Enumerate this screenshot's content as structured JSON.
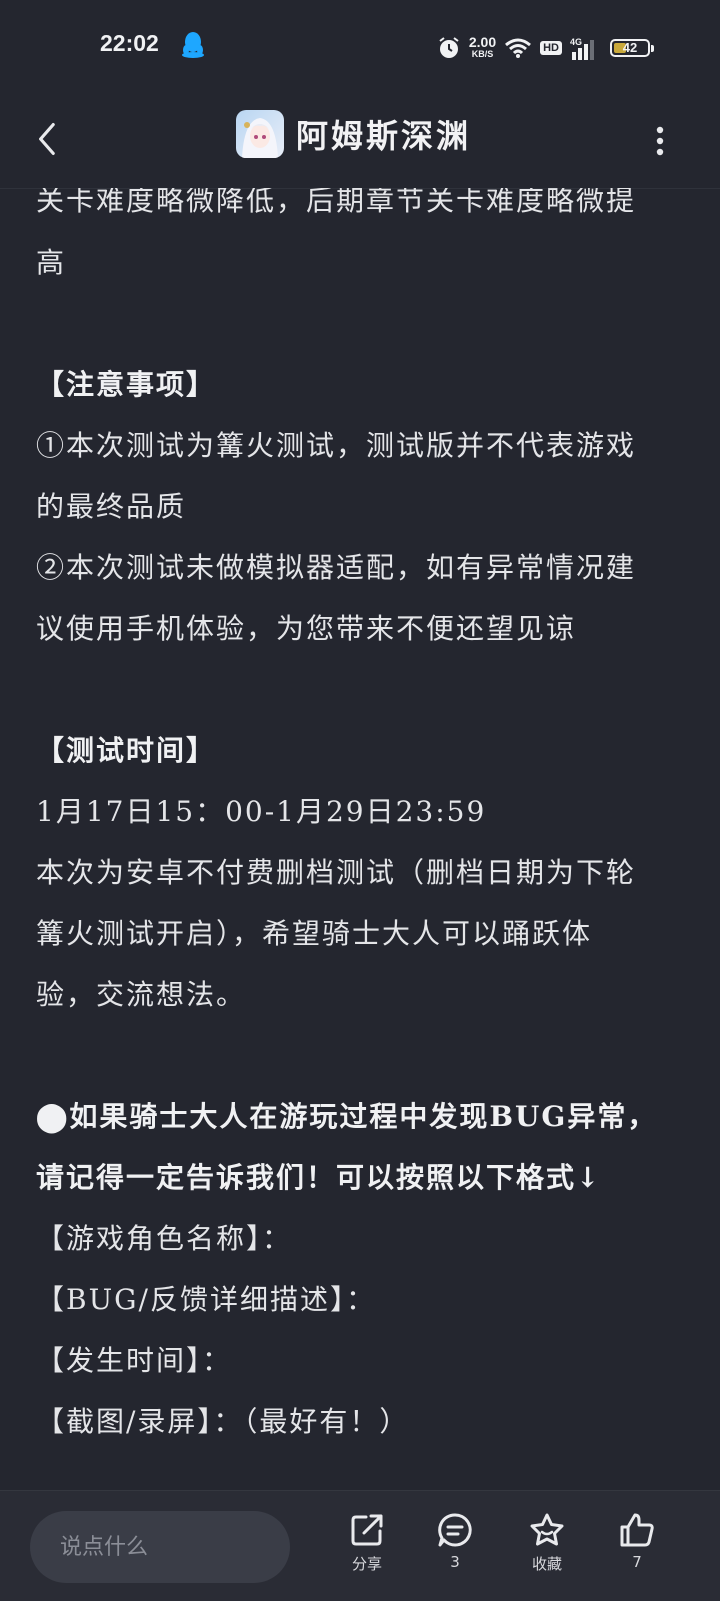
{
  "status_bar": {
    "time": "22:02",
    "net_speed_value": "2.00",
    "net_speed_unit": "KB/S",
    "hd_badge": "HD",
    "network_type": "4G",
    "battery": "42",
    "icons": [
      "qq-icon",
      "alarm-icon",
      "wifi-icon",
      "signal-icon",
      "battery-icon"
    ]
  },
  "header": {
    "title": "阿姆斯深渊",
    "back_icon": "chevron-left-icon",
    "more_icon": "more-vertical-icon"
  },
  "content": {
    "lines": [
      "关卡难度略微降低，后期章节关卡难度略微提",
      "高",
      "",
      "【注意事项】",
      "①本次测试为篝火测试，测试版并不代表游戏",
      "的最终品质",
      "②本次测试未做模拟器适配，如有异常情况建",
      "议使用手机体验，为您带来不便还望见谅",
      "",
      "【测试时间】",
      "1月17日15：00-1月29日23:59",
      "本次为安卓不付费删档测试（删档日期为下轮",
      "篝火测试开启），希望骑士大人可以踊跃体",
      "验，交流想法。",
      "",
      "⬤如果骑士大人在游玩过程中发现BUG异常，",
      "请记得一定告诉我们！可以按照以下格式↓",
      "【游戏角色名称】：",
      "【BUG/反馈详细描述】：",
      "【发生时间】：",
      "【截图/录屏】：（最好有！）"
    ]
  },
  "bottom_bar": {
    "comment_placeholder": "说点什么",
    "share_label": "分享",
    "comment_count": "3",
    "favorite_label": "收藏",
    "like_count": "7"
  },
  "colors": {
    "background": "#24262f",
    "bottom_bar": "#2a2c35",
    "input_bg": "#3a3d47",
    "text": "#e4e5e8",
    "battery_fill": "#c9a93b"
  }
}
